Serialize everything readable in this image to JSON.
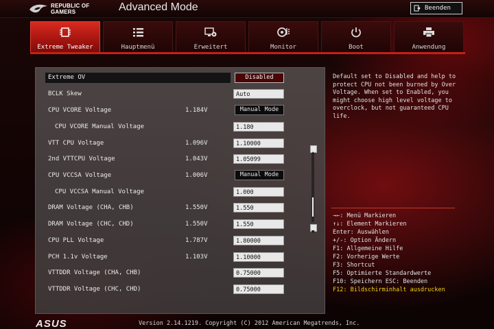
{
  "header": {
    "brand_line1": "REPUBLIC OF",
    "brand_line2": "GAMERS",
    "mode_title": "Advanced Mode",
    "exit_label": "Beenden",
    "exit_icon": "exit-door-icon"
  },
  "tabs": [
    {
      "label": "Extreme Tweaker",
      "icon": "chip-icon",
      "active": true
    },
    {
      "label": "Hauptmenü",
      "icon": "list-icon",
      "active": false
    },
    {
      "label": "Erweitert",
      "icon": "settings-monitor-icon",
      "active": false
    },
    {
      "label": "Monitor",
      "icon": "gauge-icon",
      "active": false
    },
    {
      "label": "Boot",
      "icon": "power-icon",
      "active": false
    },
    {
      "label": "Anwendung",
      "icon": "printer-icon",
      "active": false
    }
  ],
  "settings": {
    "rows": [
      {
        "label": "Extreme OV",
        "current": "",
        "value": "Disabled",
        "type": "disabled-select",
        "highlight": true
      },
      {
        "label": "BCLK Skew",
        "current": "",
        "value": "Auto",
        "type": "input"
      },
      {
        "label": "CPU VCORE Voltage",
        "current": "1.184V",
        "value": "Manual Mode",
        "type": "mode"
      },
      {
        "label": "CPU VCORE Manual Voltage",
        "current": "",
        "value": "1.180",
        "type": "input",
        "sub": true
      },
      {
        "label": "VTT CPU Voltage",
        "current": "1.096V",
        "value": "1.10000",
        "type": "input"
      },
      {
        "label": "2nd VTTCPU Voltage",
        "current": "1.043V",
        "value": "1.05099",
        "type": "input"
      },
      {
        "label": "CPU VCCSA Voltage",
        "current": "1.006V",
        "value": "Manual Mode",
        "type": "mode"
      },
      {
        "label": "CPU VCCSA Manual Voltage",
        "current": "",
        "value": "1.000",
        "type": "input",
        "sub": true
      },
      {
        "label": "DRAM Voltage (CHA, CHB)",
        "current": "1.550V",
        "value": "1.550",
        "type": "input"
      },
      {
        "label": "DRAM Voltage (CHC, CHD)",
        "current": "1.550V",
        "value": "1.550",
        "type": "input"
      },
      {
        "label": "CPU PLL Voltage",
        "current": "1.787V",
        "value": "1.80000",
        "type": "input"
      },
      {
        "label": "PCH 1.1v Voltage",
        "current": "1.103V",
        "value": "1.10000",
        "type": "input"
      },
      {
        "label": "VTTDDR Voltage (CHA, CHB)",
        "current": "",
        "value": "0.75000",
        "type": "input"
      },
      {
        "label": "VTTDDR Voltage (CHC, CHD)",
        "current": "",
        "value": "0.75000",
        "type": "input"
      }
    ]
  },
  "help": {
    "text_lines": [
      "Default set to Disabled and help to",
      "protect CPU not been burned by Over",
      "Voltage. When set to Enabled, you",
      "might choose high level voltage to",
      "overclock, but not guaranteed CPU",
      "life."
    ]
  },
  "keys": [
    "→←: Menü Markieren",
    "↑↓: Element Markieren",
    "Enter: Auswählen",
    "+/-: Option Ändern",
    "F1: Allgemeine Hilfe",
    "F2: Vorherige Werte",
    "F3: Shortcut",
    "F5: Optimierte Standardwerte",
    "F10: Speichern  ESC: Beenden"
  ],
  "key_highlight": "F12: Bildschirminhalt ausdrucken",
  "footer": {
    "brand": "ASUS",
    "version": "Version 2.14.1219. Copyright (C) 2012 American Megatrends, Inc."
  },
  "colors": {
    "accent": "#c81f17",
    "highlight_key": "#f2d218"
  }
}
